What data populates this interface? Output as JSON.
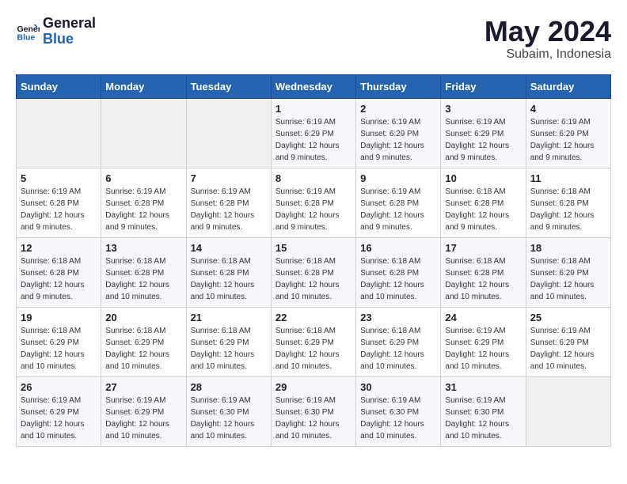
{
  "logo": {
    "line1": "General",
    "line2": "Blue"
  },
  "title": "May 2024",
  "location": "Subaim, Indonesia",
  "days_of_week": [
    "Sunday",
    "Monday",
    "Tuesday",
    "Wednesday",
    "Thursday",
    "Friday",
    "Saturday"
  ],
  "weeks": [
    [
      {
        "day": "",
        "sunrise": "",
        "sunset": "",
        "daylight": "",
        "empty": true
      },
      {
        "day": "",
        "sunrise": "",
        "sunset": "",
        "daylight": "",
        "empty": true
      },
      {
        "day": "",
        "sunrise": "",
        "sunset": "",
        "daylight": "",
        "empty": true
      },
      {
        "day": "1",
        "sunrise": "Sunrise: 6:19 AM",
        "sunset": "Sunset: 6:29 PM",
        "daylight": "Daylight: 12 hours and 9 minutes.",
        "empty": false
      },
      {
        "day": "2",
        "sunrise": "Sunrise: 6:19 AM",
        "sunset": "Sunset: 6:29 PM",
        "daylight": "Daylight: 12 hours and 9 minutes.",
        "empty": false
      },
      {
        "day": "3",
        "sunrise": "Sunrise: 6:19 AM",
        "sunset": "Sunset: 6:29 PM",
        "daylight": "Daylight: 12 hours and 9 minutes.",
        "empty": false
      },
      {
        "day": "4",
        "sunrise": "Sunrise: 6:19 AM",
        "sunset": "Sunset: 6:29 PM",
        "daylight": "Daylight: 12 hours and 9 minutes.",
        "empty": false
      }
    ],
    [
      {
        "day": "5",
        "sunrise": "Sunrise: 6:19 AM",
        "sunset": "Sunset: 6:28 PM",
        "daylight": "Daylight: 12 hours and 9 minutes.",
        "empty": false
      },
      {
        "day": "6",
        "sunrise": "Sunrise: 6:19 AM",
        "sunset": "Sunset: 6:28 PM",
        "daylight": "Daylight: 12 hours and 9 minutes.",
        "empty": false
      },
      {
        "day": "7",
        "sunrise": "Sunrise: 6:19 AM",
        "sunset": "Sunset: 6:28 PM",
        "daylight": "Daylight: 12 hours and 9 minutes.",
        "empty": false
      },
      {
        "day": "8",
        "sunrise": "Sunrise: 6:19 AM",
        "sunset": "Sunset: 6:28 PM",
        "daylight": "Daylight: 12 hours and 9 minutes.",
        "empty": false
      },
      {
        "day": "9",
        "sunrise": "Sunrise: 6:19 AM",
        "sunset": "Sunset: 6:28 PM",
        "daylight": "Daylight: 12 hours and 9 minutes.",
        "empty": false
      },
      {
        "day": "10",
        "sunrise": "Sunrise: 6:18 AM",
        "sunset": "Sunset: 6:28 PM",
        "daylight": "Daylight: 12 hours and 9 minutes.",
        "empty": false
      },
      {
        "day": "11",
        "sunrise": "Sunrise: 6:18 AM",
        "sunset": "Sunset: 6:28 PM",
        "daylight": "Daylight: 12 hours and 9 minutes.",
        "empty": false
      }
    ],
    [
      {
        "day": "12",
        "sunrise": "Sunrise: 6:18 AM",
        "sunset": "Sunset: 6:28 PM",
        "daylight": "Daylight: 12 hours and 9 minutes.",
        "empty": false
      },
      {
        "day": "13",
        "sunrise": "Sunrise: 6:18 AM",
        "sunset": "Sunset: 6:28 PM",
        "daylight": "Daylight: 12 hours and 10 minutes.",
        "empty": false
      },
      {
        "day": "14",
        "sunrise": "Sunrise: 6:18 AM",
        "sunset": "Sunset: 6:28 PM",
        "daylight": "Daylight: 12 hours and 10 minutes.",
        "empty": false
      },
      {
        "day": "15",
        "sunrise": "Sunrise: 6:18 AM",
        "sunset": "Sunset: 6:28 PM",
        "daylight": "Daylight: 12 hours and 10 minutes.",
        "empty": false
      },
      {
        "day": "16",
        "sunrise": "Sunrise: 6:18 AM",
        "sunset": "Sunset: 6:28 PM",
        "daylight": "Daylight: 12 hours and 10 minutes.",
        "empty": false
      },
      {
        "day": "17",
        "sunrise": "Sunrise: 6:18 AM",
        "sunset": "Sunset: 6:28 PM",
        "daylight": "Daylight: 12 hours and 10 minutes.",
        "empty": false
      },
      {
        "day": "18",
        "sunrise": "Sunrise: 6:18 AM",
        "sunset": "Sunset: 6:29 PM",
        "daylight": "Daylight: 12 hours and 10 minutes.",
        "empty": false
      }
    ],
    [
      {
        "day": "19",
        "sunrise": "Sunrise: 6:18 AM",
        "sunset": "Sunset: 6:29 PM",
        "daylight": "Daylight: 12 hours and 10 minutes.",
        "empty": false
      },
      {
        "day": "20",
        "sunrise": "Sunrise: 6:18 AM",
        "sunset": "Sunset: 6:29 PM",
        "daylight": "Daylight: 12 hours and 10 minutes.",
        "empty": false
      },
      {
        "day": "21",
        "sunrise": "Sunrise: 6:18 AM",
        "sunset": "Sunset: 6:29 PM",
        "daylight": "Daylight: 12 hours and 10 minutes.",
        "empty": false
      },
      {
        "day": "22",
        "sunrise": "Sunrise: 6:18 AM",
        "sunset": "Sunset: 6:29 PM",
        "daylight": "Daylight: 12 hours and 10 minutes.",
        "empty": false
      },
      {
        "day": "23",
        "sunrise": "Sunrise: 6:18 AM",
        "sunset": "Sunset: 6:29 PM",
        "daylight": "Daylight: 12 hours and 10 minutes.",
        "empty": false
      },
      {
        "day": "24",
        "sunrise": "Sunrise: 6:19 AM",
        "sunset": "Sunset: 6:29 PM",
        "daylight": "Daylight: 12 hours and 10 minutes.",
        "empty": false
      },
      {
        "day": "25",
        "sunrise": "Sunrise: 6:19 AM",
        "sunset": "Sunset: 6:29 PM",
        "daylight": "Daylight: 12 hours and 10 minutes.",
        "empty": false
      }
    ],
    [
      {
        "day": "26",
        "sunrise": "Sunrise: 6:19 AM",
        "sunset": "Sunset: 6:29 PM",
        "daylight": "Daylight: 12 hours and 10 minutes.",
        "empty": false
      },
      {
        "day": "27",
        "sunrise": "Sunrise: 6:19 AM",
        "sunset": "Sunset: 6:29 PM",
        "daylight": "Daylight: 12 hours and 10 minutes.",
        "empty": false
      },
      {
        "day": "28",
        "sunrise": "Sunrise: 6:19 AM",
        "sunset": "Sunset: 6:30 PM",
        "daylight": "Daylight: 12 hours and 10 minutes.",
        "empty": false
      },
      {
        "day": "29",
        "sunrise": "Sunrise: 6:19 AM",
        "sunset": "Sunset: 6:30 PM",
        "daylight": "Daylight: 12 hours and 10 minutes.",
        "empty": false
      },
      {
        "day": "30",
        "sunrise": "Sunrise: 6:19 AM",
        "sunset": "Sunset: 6:30 PM",
        "daylight": "Daylight: 12 hours and 10 minutes.",
        "empty": false
      },
      {
        "day": "31",
        "sunrise": "Sunrise: 6:19 AM",
        "sunset": "Sunset: 6:30 PM",
        "daylight": "Daylight: 12 hours and 10 minutes.",
        "empty": false
      },
      {
        "day": "",
        "sunrise": "",
        "sunset": "",
        "daylight": "",
        "empty": true
      }
    ]
  ]
}
